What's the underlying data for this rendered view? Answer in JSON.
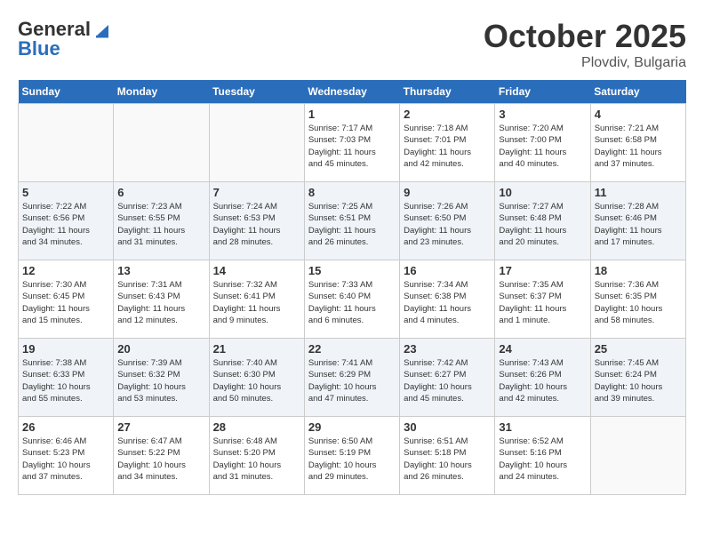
{
  "header": {
    "logo_line1": "General",
    "logo_line2": "Blue",
    "month": "October 2025",
    "location": "Plovdiv, Bulgaria"
  },
  "weekdays": [
    "Sunday",
    "Monday",
    "Tuesday",
    "Wednesday",
    "Thursday",
    "Friday",
    "Saturday"
  ],
  "weeks": [
    [
      {
        "day": "",
        "info": ""
      },
      {
        "day": "",
        "info": ""
      },
      {
        "day": "",
        "info": ""
      },
      {
        "day": "1",
        "info": "Sunrise: 7:17 AM\nSunset: 7:03 PM\nDaylight: 11 hours\nand 45 minutes."
      },
      {
        "day": "2",
        "info": "Sunrise: 7:18 AM\nSunset: 7:01 PM\nDaylight: 11 hours\nand 42 minutes."
      },
      {
        "day": "3",
        "info": "Sunrise: 7:20 AM\nSunset: 7:00 PM\nDaylight: 11 hours\nand 40 minutes."
      },
      {
        "day": "4",
        "info": "Sunrise: 7:21 AM\nSunset: 6:58 PM\nDaylight: 11 hours\nand 37 minutes."
      }
    ],
    [
      {
        "day": "5",
        "info": "Sunrise: 7:22 AM\nSunset: 6:56 PM\nDaylight: 11 hours\nand 34 minutes."
      },
      {
        "day": "6",
        "info": "Sunrise: 7:23 AM\nSunset: 6:55 PM\nDaylight: 11 hours\nand 31 minutes."
      },
      {
        "day": "7",
        "info": "Sunrise: 7:24 AM\nSunset: 6:53 PM\nDaylight: 11 hours\nand 28 minutes."
      },
      {
        "day": "8",
        "info": "Sunrise: 7:25 AM\nSunset: 6:51 PM\nDaylight: 11 hours\nand 26 minutes."
      },
      {
        "day": "9",
        "info": "Sunrise: 7:26 AM\nSunset: 6:50 PM\nDaylight: 11 hours\nand 23 minutes."
      },
      {
        "day": "10",
        "info": "Sunrise: 7:27 AM\nSunset: 6:48 PM\nDaylight: 11 hours\nand 20 minutes."
      },
      {
        "day": "11",
        "info": "Sunrise: 7:28 AM\nSunset: 6:46 PM\nDaylight: 11 hours\nand 17 minutes."
      }
    ],
    [
      {
        "day": "12",
        "info": "Sunrise: 7:30 AM\nSunset: 6:45 PM\nDaylight: 11 hours\nand 15 minutes."
      },
      {
        "day": "13",
        "info": "Sunrise: 7:31 AM\nSunset: 6:43 PM\nDaylight: 11 hours\nand 12 minutes."
      },
      {
        "day": "14",
        "info": "Sunrise: 7:32 AM\nSunset: 6:41 PM\nDaylight: 11 hours\nand 9 minutes."
      },
      {
        "day": "15",
        "info": "Sunrise: 7:33 AM\nSunset: 6:40 PM\nDaylight: 11 hours\nand 6 minutes."
      },
      {
        "day": "16",
        "info": "Sunrise: 7:34 AM\nSunset: 6:38 PM\nDaylight: 11 hours\nand 4 minutes."
      },
      {
        "day": "17",
        "info": "Sunrise: 7:35 AM\nSunset: 6:37 PM\nDaylight: 11 hours\nand 1 minute."
      },
      {
        "day": "18",
        "info": "Sunrise: 7:36 AM\nSunset: 6:35 PM\nDaylight: 10 hours\nand 58 minutes."
      }
    ],
    [
      {
        "day": "19",
        "info": "Sunrise: 7:38 AM\nSunset: 6:33 PM\nDaylight: 10 hours\nand 55 minutes."
      },
      {
        "day": "20",
        "info": "Sunrise: 7:39 AM\nSunset: 6:32 PM\nDaylight: 10 hours\nand 53 minutes."
      },
      {
        "day": "21",
        "info": "Sunrise: 7:40 AM\nSunset: 6:30 PM\nDaylight: 10 hours\nand 50 minutes."
      },
      {
        "day": "22",
        "info": "Sunrise: 7:41 AM\nSunset: 6:29 PM\nDaylight: 10 hours\nand 47 minutes."
      },
      {
        "day": "23",
        "info": "Sunrise: 7:42 AM\nSunset: 6:27 PM\nDaylight: 10 hours\nand 45 minutes."
      },
      {
        "day": "24",
        "info": "Sunrise: 7:43 AM\nSunset: 6:26 PM\nDaylight: 10 hours\nand 42 minutes."
      },
      {
        "day": "25",
        "info": "Sunrise: 7:45 AM\nSunset: 6:24 PM\nDaylight: 10 hours\nand 39 minutes."
      }
    ],
    [
      {
        "day": "26",
        "info": "Sunrise: 6:46 AM\nSunset: 5:23 PM\nDaylight: 10 hours\nand 37 minutes."
      },
      {
        "day": "27",
        "info": "Sunrise: 6:47 AM\nSunset: 5:22 PM\nDaylight: 10 hours\nand 34 minutes."
      },
      {
        "day": "28",
        "info": "Sunrise: 6:48 AM\nSunset: 5:20 PM\nDaylight: 10 hours\nand 31 minutes."
      },
      {
        "day": "29",
        "info": "Sunrise: 6:50 AM\nSunset: 5:19 PM\nDaylight: 10 hours\nand 29 minutes."
      },
      {
        "day": "30",
        "info": "Sunrise: 6:51 AM\nSunset: 5:18 PM\nDaylight: 10 hours\nand 26 minutes."
      },
      {
        "day": "31",
        "info": "Sunrise: 6:52 AM\nSunset: 5:16 PM\nDaylight: 10 hours\nand 24 minutes."
      },
      {
        "day": "",
        "info": ""
      }
    ]
  ]
}
